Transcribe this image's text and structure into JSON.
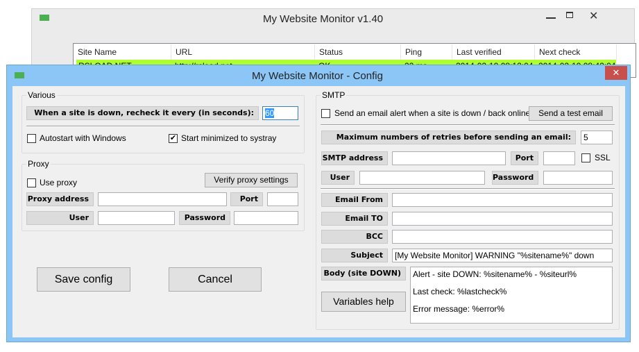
{
  "main_window": {
    "title": "My Website Monitor v1.40",
    "columns": [
      "Site Name",
      "URL",
      "Status",
      "Ping",
      "Last verified",
      "Next check"
    ],
    "rows": [
      {
        "site": "RSLOAD.NET",
        "url": "http://rsload.net",
        "status": "OK",
        "ping": "22 ms",
        "last": "2014-02-19 08:12:04",
        "next": "2014-02-19 08:42:04"
      }
    ],
    "row_color": "#adff2f"
  },
  "config": {
    "title": "My Website Monitor - Config",
    "various": {
      "legend": "Various",
      "recheck_label": "When a site is down, recheck it every (in seconds):",
      "recheck_value": "60",
      "autostart": "Autostart with Windows",
      "autostart_checked": false,
      "minimized": "Start minimized to systray",
      "minimized_checked": true
    },
    "proxy": {
      "legend": "Proxy",
      "use_proxy": "Use proxy",
      "verify": "Verify proxy settings",
      "address": "Proxy address",
      "port": "Port",
      "user": "User",
      "password": "Password"
    },
    "save": "Save config",
    "cancel": "Cancel",
    "smtp": {
      "legend": "SMTP",
      "send_alert": "Send an email alert when a site is down / back online",
      "test": "Send a test email",
      "retries_label": "Maximum numbers of retries before sending an email:",
      "retries_value": "5",
      "address": "SMTP address",
      "port": "Port",
      "ssl": "SSL",
      "user": "User",
      "password": "Password",
      "from": "Email From",
      "to": "Email TO",
      "bcc": "BCC",
      "subject": "Subject",
      "subject_value": "[My Website Monitor] WARNING \"%sitename%\" down",
      "body": "Body (site DOWN)",
      "body_lines": [
        "Alert - site DOWN: %sitename% - %siteurl%",
        "Last check: %lastcheck%",
        "Error message: %error%"
      ],
      "variables": "Variables help"
    }
  }
}
